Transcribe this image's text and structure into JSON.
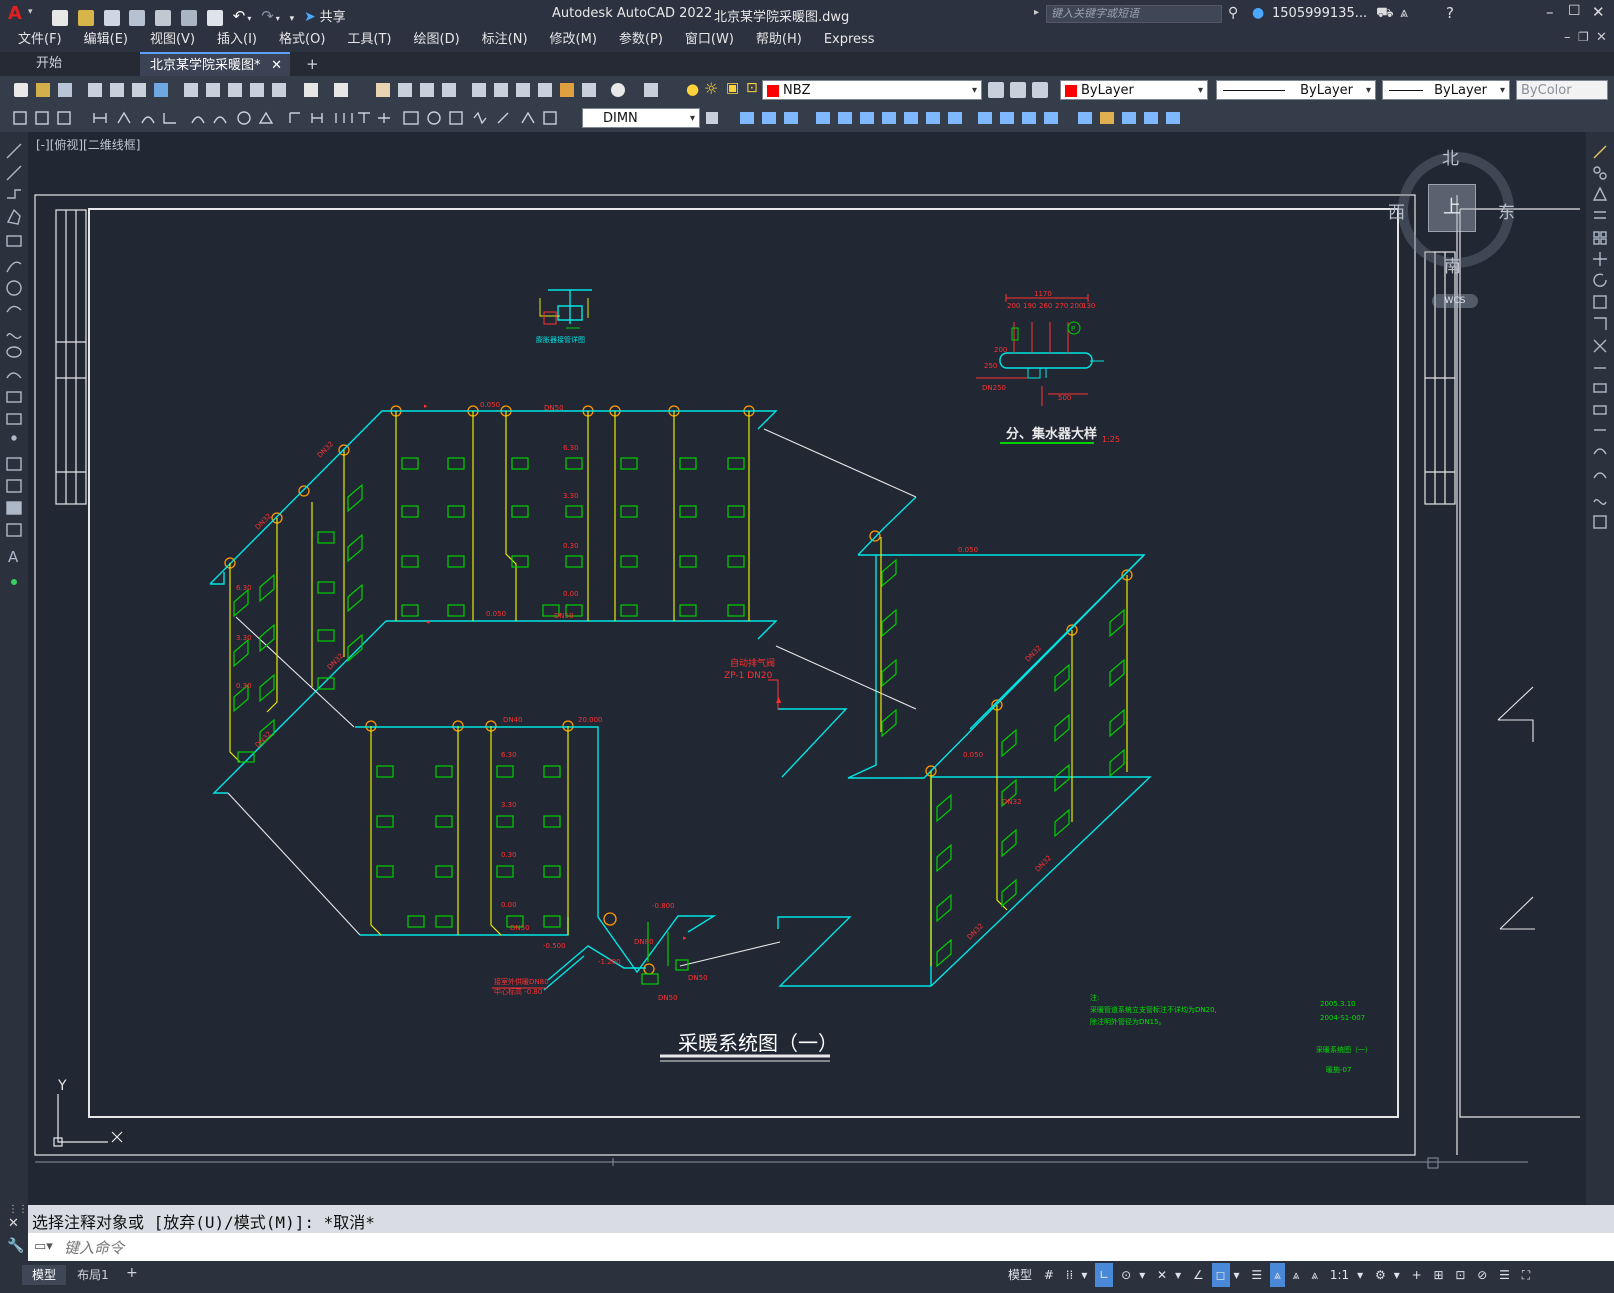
{
  "app": {
    "title": "Autodesk AutoCAD 2022",
    "file": "北京某学院采暖图.dwg",
    "share_label": "共享",
    "search_placeholder": "键入关键字或短语",
    "user": "1505999135...",
    "logo": "A"
  },
  "menu": [
    "文件(F)",
    "编辑(E)",
    "视图(V)",
    "插入(I)",
    "格式(O)",
    "工具(T)",
    "绘图(D)",
    "标注(N)",
    "修改(M)",
    "参数(P)",
    "窗口(W)",
    "帮助(H)",
    "Express"
  ],
  "tabs": {
    "start": "开始",
    "active": "北京某学院采暖图*",
    "close": "✕",
    "add": "+"
  },
  "toolbar": {
    "layer": "NBZ",
    "layer_color": "#ff0000",
    "color": "ByLayer",
    "color_swatch": "#ff0000",
    "linetype": "ByLayer",
    "lineweight": "ByLayer",
    "plotstyle": "ByColor",
    "dimstyle": "DIMN"
  },
  "viewport": {
    "label": "[-][俯视][二维线框]",
    "viewcube": {
      "north": "北",
      "south": "南",
      "east": "东",
      "west": "西",
      "top": "上",
      "wcs": "WCS"
    },
    "ucs_y": "Y",
    "ucs_x": "X"
  },
  "drawing": {
    "title": "采暖系统图（一）",
    "detail_title": "分、集水器大样",
    "detail_scale": "1:25",
    "detail_dims": [
      "1170",
      "200",
      "190",
      "260",
      "270",
      "200",
      "130",
      "500",
      "250",
      "200",
      "DN250",
      "P"
    ],
    "small_detail_caption": "膨胀器接管详图",
    "vent_label_1": "自动排气阀",
    "vent_label_2": "ZP-1 DN20",
    "notes_1": "注:",
    "notes_2": "采暖管道系统立支管标注不详均为DN20,",
    "notes_3": "除注明外管径为DN15。",
    "stamp_date": "2005.3.10",
    "stamp_no": "2004-S1-007",
    "stamp_title": "采暖系统图（一）",
    "stamp_sheet": "暖施-07",
    "supply_label_1": "接室外供暖DN80",
    "supply_label_2": "中心标高 -0.80"
  },
  "command": {
    "history": "选择注释对象或 [放弃(U)/模式(M)]: *取消*",
    "placeholder": "键入命令"
  },
  "layout_tabs": [
    "模型",
    "布局1"
  ],
  "status": {
    "model": "模型",
    "scale": "1:1"
  },
  "colors": {
    "cyan": "#00e5e5",
    "yellow": "#e8e800",
    "green": "#00d000",
    "red": "#ff3030",
    "white": "#e8e8e8",
    "orange": "#ff9900",
    "bg": "#212733"
  }
}
